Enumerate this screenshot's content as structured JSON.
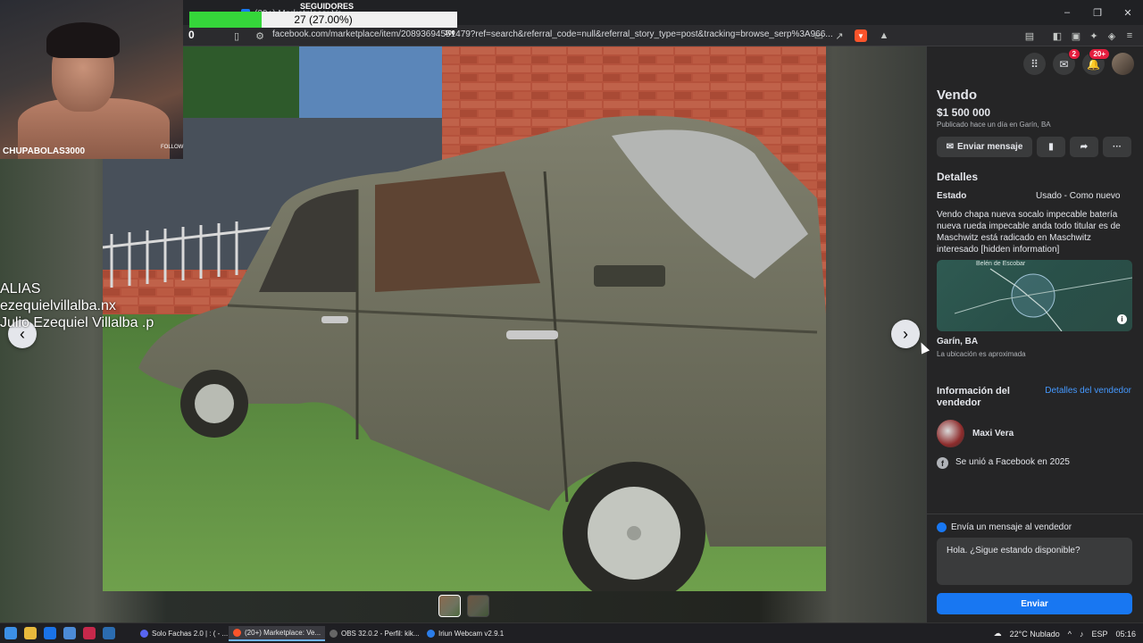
{
  "browser": {
    "tab_title": "(20+) Marketplace: Ve...",
    "url": "facebook.com/marketplace/item/20893694551479?ref=search&referral_code=null&referral_story_type=post&tracking=browse_serp%3A966...",
    "brave_badge": "9",
    "window_controls": [
      "–",
      "❐",
      "✕"
    ]
  },
  "stream_overlay": {
    "webcam_name": "CHUPABOLAS3000",
    "webcam_follow": "FOLLOW",
    "followers_title": "SEGUIDORES",
    "followers_label": "27 (27.00%)",
    "followers_progress": 0.27,
    "followers_start": "0",
    "followers_end": "100",
    "alias_lines": [
      "ALIAS",
      "ezequielvillalba.nx",
      "Julio Ezequiel Villalba .p"
    ]
  },
  "viewer": {
    "prev_symbol": "‹",
    "next_symbol": "›",
    "thumbnails": [
      {
        "active": true
      },
      {
        "active": false
      }
    ]
  },
  "sidebar": {
    "top_icons": [
      {
        "name": "menu-grid-icon",
        "glyph": "⠿",
        "badge": ""
      },
      {
        "name": "messenger-icon",
        "glyph": "✉",
        "badge": "2"
      },
      {
        "name": "bell-icon",
        "glyph": "🔔",
        "badge": "20+"
      }
    ],
    "title": "Vendo",
    "price": "$1 500 000",
    "posted": "Publicado hace un día en Garín, BA",
    "send_message_label": "Enviar mensaje",
    "details_heading": "Detalles",
    "estado_key": "Estado",
    "estado_value": "Usado - Como nuevo",
    "description": "Vendo chapa nueva socalo impecable batería nueva rueda impecable anda todo titular es de Maschwitz está radicado en Maschwitz interesado [hidden information]",
    "map_label": "Belén de Escobar",
    "location": "Garín, BA",
    "location_note": "La ubicación es aproximada",
    "seller_heading": "Información del vendedor",
    "seller_link": "Detalles del vendedor",
    "seller_name": "Maxi Vera",
    "joined": "Se unió a Facebook en 2025",
    "message_heading": "Envía un mensaje al vendedor",
    "message_text": "Hola. ¿Sigue estando disponible?",
    "send_label": "Enviar"
  },
  "taskbar": {
    "apps": [
      {
        "label": "Solo Fachas 2.0 | : ( - ...",
        "color": "#5865f2"
      },
      {
        "label": "(20+) Marketplace: Ve...",
        "color": "#fb542b"
      },
      {
        "label": "OBS 32.0.2 - Perfil: kik...",
        "color": "#444"
      },
      {
        "label": "Iriun Webcam v2.9.1",
        "color": "#2b7de9"
      }
    ],
    "weather": "22°C  Nublado",
    "lang": "ESP",
    "time": "05:16"
  }
}
